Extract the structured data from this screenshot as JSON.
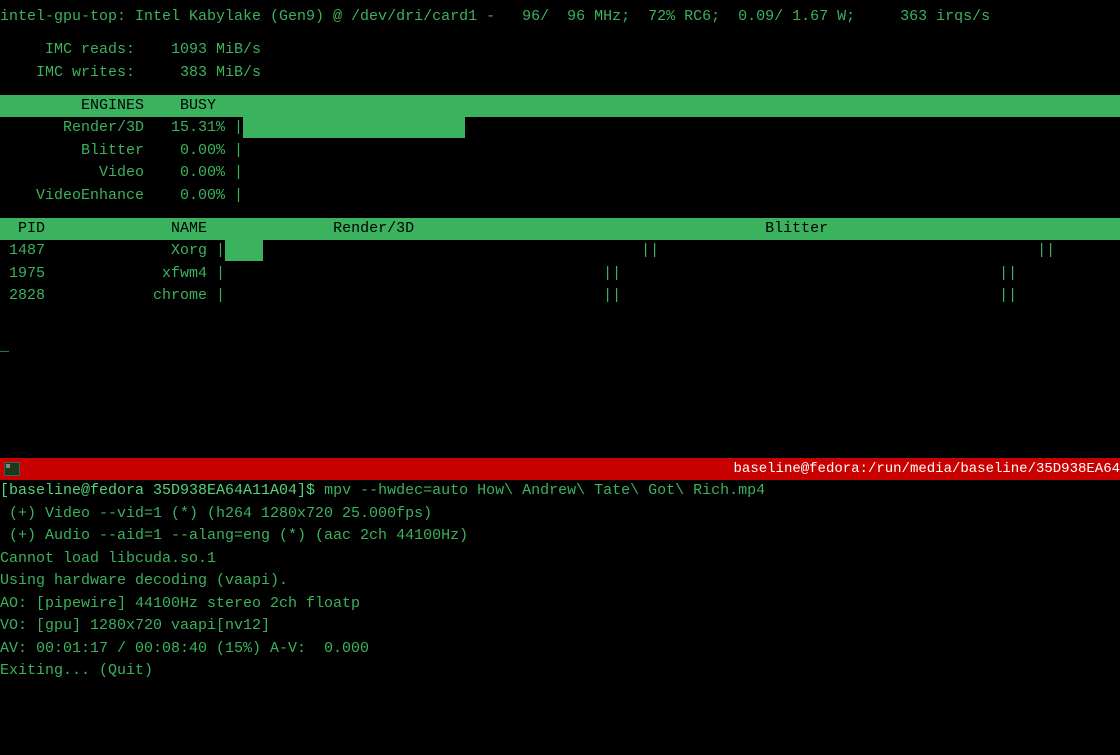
{
  "header": {
    "line": "intel-gpu-top: Intel Kabylake (Gen9) @ /dev/dri/card1 -   96/  96 MHz;  72% RC6;  0.09/ 1.67 W;     363 irqs/s"
  },
  "imc": {
    "reads_label": "     IMC reads:    1093 MiB/s",
    "writes_label": "    IMC writes:     383 MiB/s"
  },
  "engines_header": "         ENGINES    BUSY",
  "engines": [
    {
      "label": "       Render/3D   15.31% |",
      "bar_pct": 27
    },
    {
      "label": "         Blitter    0.00% |",
      "bar_pct": 0
    },
    {
      "label": "           Video    0.00% |",
      "bar_pct": 0
    },
    {
      "label": "    VideoEnhance    0.00% |",
      "bar_pct": 0
    }
  ],
  "proc_header": {
    "pid": "  PID",
    "name": "              NAME",
    "col1": "              Render/3D",
    "col2": "                                       Blitter"
  },
  "procs": [
    {
      "pid": " 1487",
      "name": "              Xorg |",
      "bar_pct": 5,
      "mid": "                                          ||                                          ||"
    },
    {
      "pid": " 1975",
      "name": "             xfwm4 |",
      "bar_pct": 0,
      "mid": "                                          ||                                          ||"
    },
    {
      "pid": " 2828",
      "name": "            chrome |",
      "bar_pct": 0,
      "mid": "                                          ||                                          ||"
    }
  ],
  "dash": "_",
  "redbar": {
    "title": "baseline@fedora:/run/media/baseline/35D938EA64"
  },
  "bottom": {
    "prompt_pre": "[baseline@fedora 35D938EA64A11A04]$ ",
    "cmd": "mpv --hwdec=auto How\\ Andrew\\ Tate\\ Got\\ Rich.mp4",
    "lines": [
      " (+) Video --vid=1 (*) (h264 1280x720 25.000fps)",
      " (+) Audio --aid=1 --alang=eng (*) (aac 2ch 44100Hz)",
      "Cannot load libcuda.so.1",
      "Using hardware decoding (vaapi).",
      "AO: [pipewire] 44100Hz stereo 2ch floatp",
      "VO: [gpu] 1280x720 vaapi[nv12]",
      "AV: 00:01:17 / 00:08:40 (15%) A-V:  0.000",
      "",
      "Exiting... (Quit)"
    ]
  }
}
